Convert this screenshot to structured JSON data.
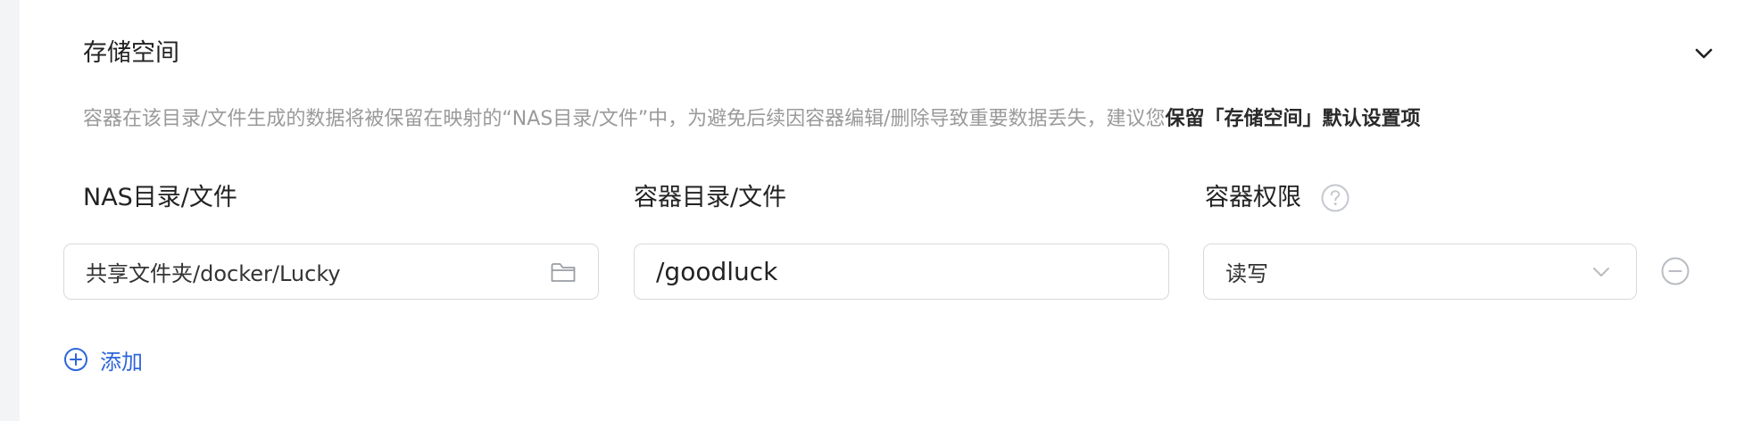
{
  "section": {
    "title": "存储空间",
    "hint_prefix": "容器在该目录/文件生成的数据将被保留在映射的“NAS目录/文件”中，为避免后续因容器编辑/删除导致重要数据丢失，建议您",
    "hint_bold": "保留「存储空间」默认设置项"
  },
  "columns": {
    "nas": "NAS目录/文件",
    "container": "容器目录/文件",
    "permission": "容器权限"
  },
  "row": {
    "nas_path": "共享文件夹/docker/Lucky",
    "container_path": "/goodluck",
    "permission": "读写"
  },
  "actions": {
    "add_label": "添加"
  },
  "colors": {
    "accent": "#2f66d9",
    "border": "#d7d9de",
    "muted_text": "#9a9a9a"
  }
}
